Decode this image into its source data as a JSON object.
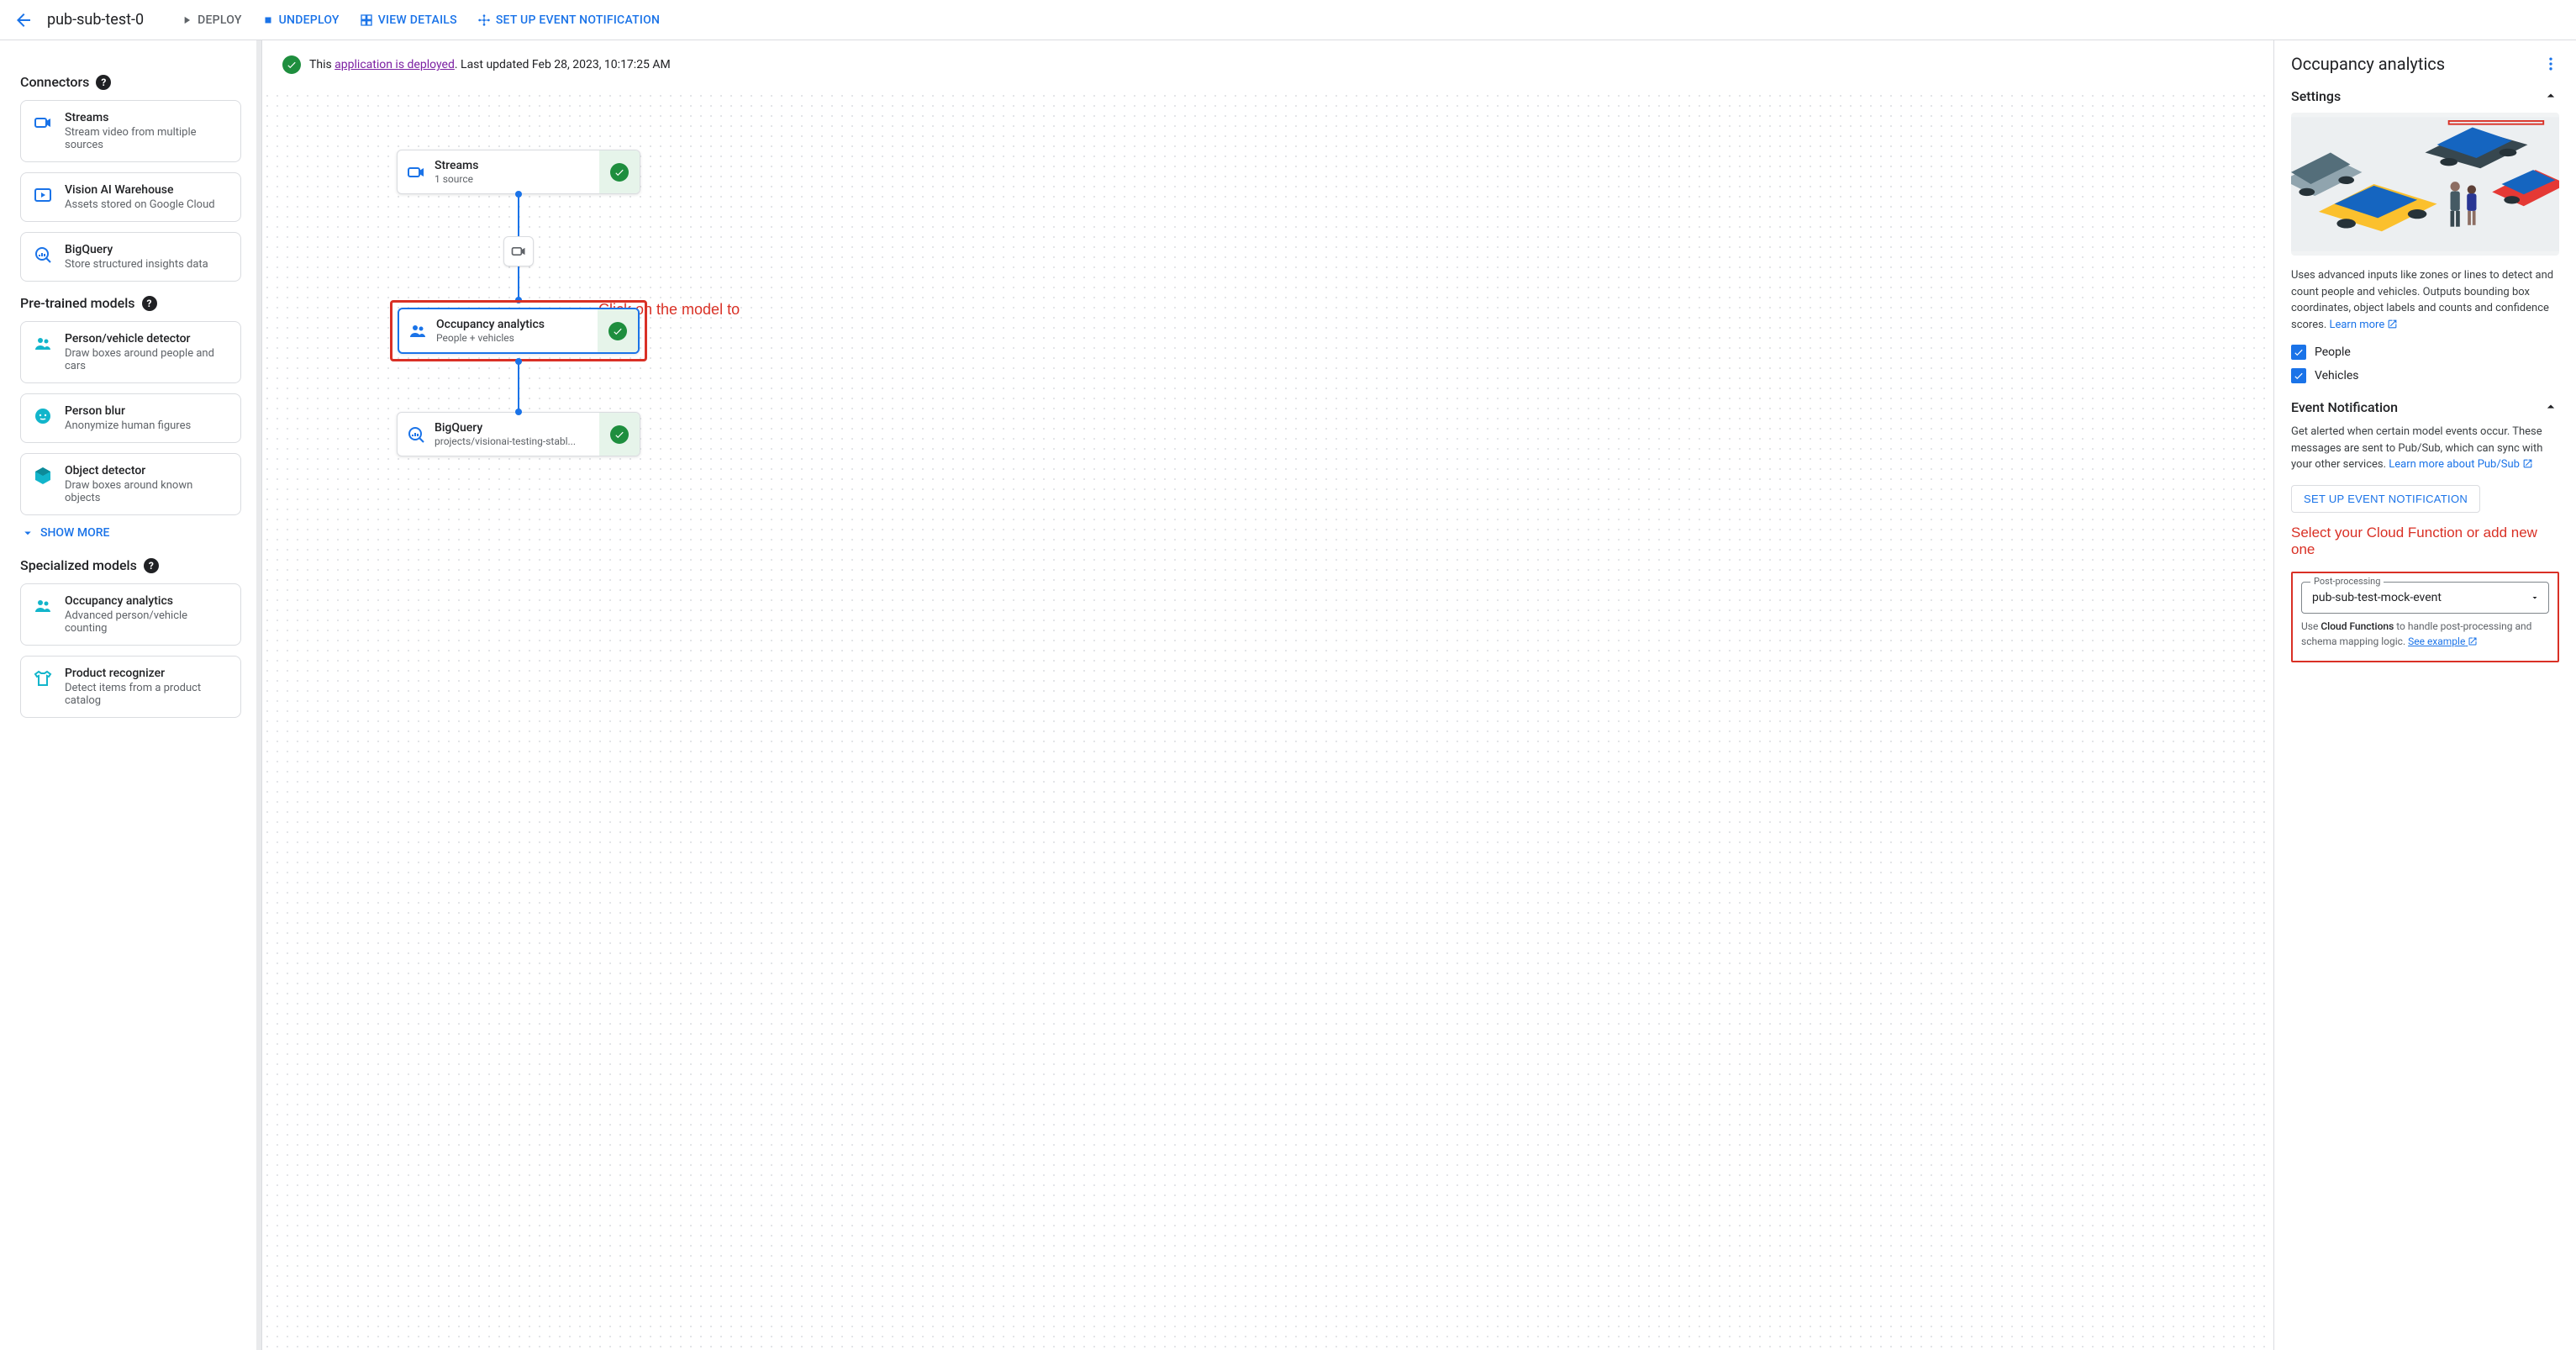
{
  "header": {
    "title": "pub-sub-test-0",
    "deploy": "DEPLOY",
    "undeploy": "UNDEPLOY",
    "view_details": "VIEW DETAILS",
    "set_up_event": "SET UP EVENT NOTIFICATION"
  },
  "status": {
    "prefix": "This ",
    "link": "application is deployed",
    "suffix": ". Last updated Feb 28, 2023, 10:17:25 AM"
  },
  "sidebar": {
    "connectors_title": "Connectors",
    "pretrained_title": "Pre-trained models",
    "specialized_title": "Specialized models",
    "show_more": "SHOW MORE",
    "connectors": [
      {
        "title": "Streams",
        "sub": "Stream video from multiple sources"
      },
      {
        "title": "Vision AI Warehouse",
        "sub": "Assets stored on Google Cloud"
      },
      {
        "title": "BigQuery",
        "sub": "Store structured insights data"
      }
    ],
    "pretrained": [
      {
        "title": "Person/vehicle detector",
        "sub": "Draw boxes around people and cars"
      },
      {
        "title": "Person blur",
        "sub": "Anonymize human figures"
      },
      {
        "title": "Object detector",
        "sub": "Draw boxes around known objects"
      }
    ],
    "specialized": [
      {
        "title": "Occupancy analytics",
        "sub": "Advanced person/vehicle counting"
      },
      {
        "title": "Product recognizer",
        "sub": "Detect items from a product catalog"
      }
    ]
  },
  "flow": {
    "streams": {
      "title": "Streams",
      "sub": "1 source"
    },
    "occupancy": {
      "title": "Occupancy analytics",
      "sub": "People + vehicles"
    },
    "bigquery": {
      "title": "BigQuery",
      "sub": "projects/visionai-testing-stabl..."
    },
    "annot1": "Click on the model to edit"
  },
  "right": {
    "title": "Occupancy analytics",
    "settings_title": "Settings",
    "desc": "Uses advanced inputs like zones or lines to detect and count people and vehicles. Outputs bounding box coordinates, object labels and counts and confidence scores. ",
    "learn_more": "Learn more",
    "cb_people": "People",
    "cb_vehicles": "Vehicles",
    "event_title": "Event Notification",
    "event_desc": "Get alerted when certain model events occur. These messages are sent to Pub/Sub, which can sync with your other services. ",
    "event_link": "Learn more about Pub/Sub",
    "setup_btn": "SET UP EVENT NOTIFICATION",
    "annot2": "Select your Cloud Function or add new one",
    "pp_label": "Post-processing",
    "pp_value": "pub-sub-test-mock-event",
    "pp_hint_pre": "Use ",
    "pp_hint_bold": "Cloud Functions",
    "pp_hint_post": " to handle post-processing and schema mapping logic. ",
    "pp_example": "See example"
  }
}
